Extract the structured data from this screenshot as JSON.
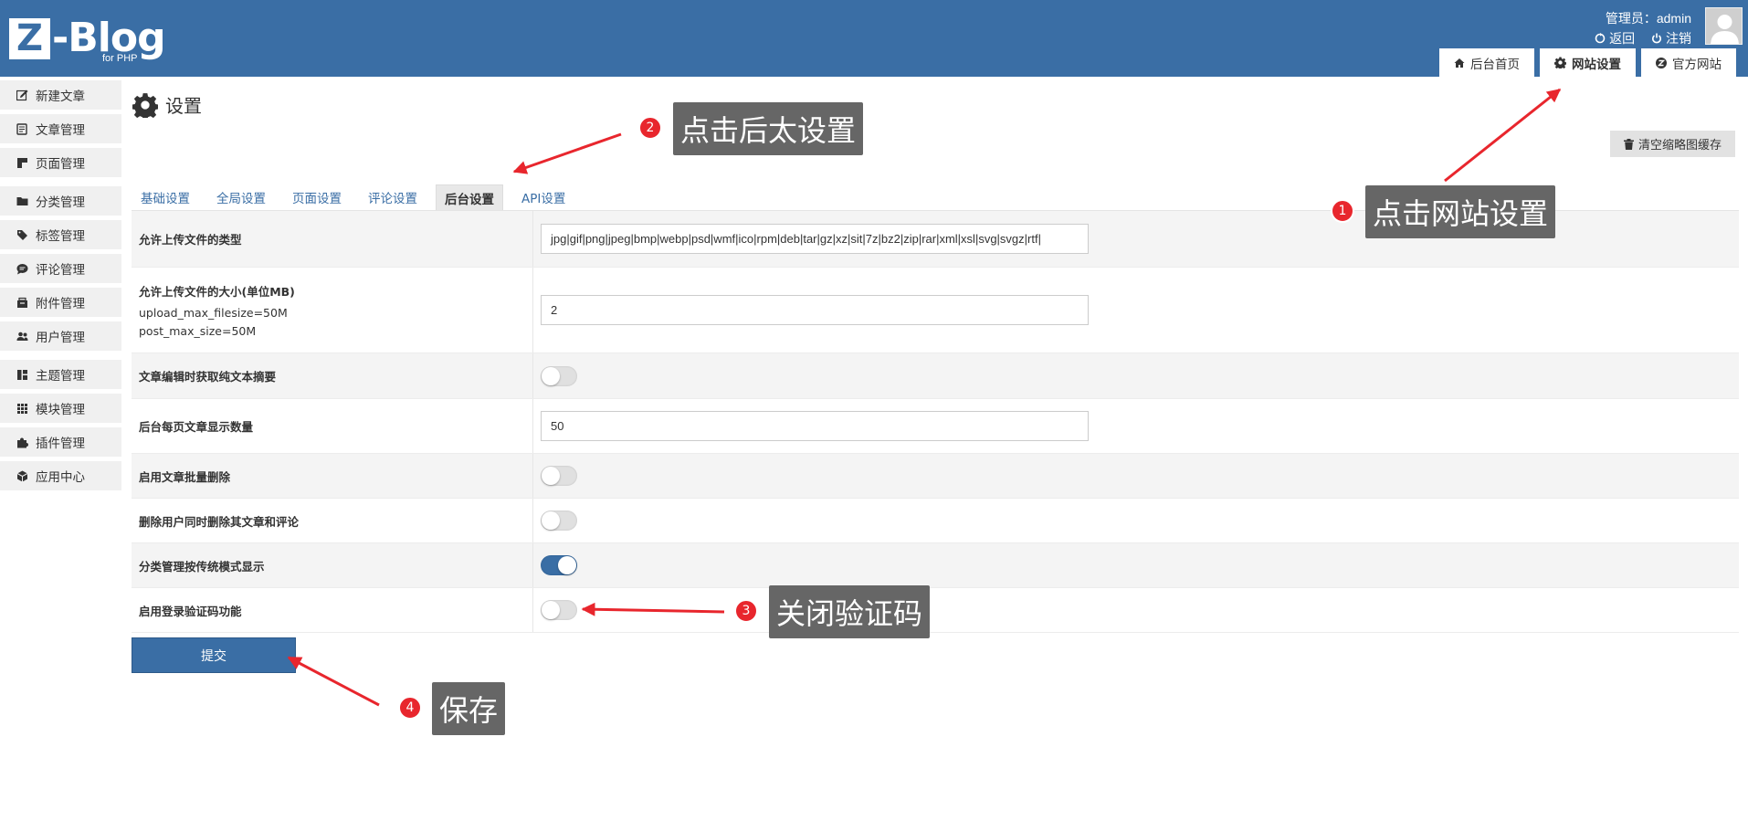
{
  "header": {
    "logo_z": "Z",
    "logo_text": "-Blog",
    "logo_sub": "for PHP",
    "user_label": "管理员：admin",
    "back_label": "返回",
    "logout_label": "注销",
    "nav": [
      {
        "label": "后台首页",
        "icon": "home-icon"
      },
      {
        "label": "网站设置",
        "icon": "gear-icon"
      },
      {
        "label": "官方网站",
        "icon": "zblog-icon"
      }
    ]
  },
  "sidebar": {
    "items": [
      {
        "label": "新建文章",
        "icon": "edit-icon"
      },
      {
        "label": "文章管理",
        "icon": "article-icon"
      },
      {
        "label": "页面管理",
        "icon": "page-icon"
      },
      {
        "label": "分类管理",
        "icon": "folder-icon"
      },
      {
        "label": "标签管理",
        "icon": "tag-icon"
      },
      {
        "label": "评论管理",
        "icon": "comment-icon"
      },
      {
        "label": "附件管理",
        "icon": "attachment-icon"
      },
      {
        "label": "用户管理",
        "icon": "users-icon"
      },
      {
        "label": "主题管理",
        "icon": "theme-icon"
      },
      {
        "label": "模块管理",
        "icon": "grid-icon"
      },
      {
        "label": "插件管理",
        "icon": "puzzle-icon"
      },
      {
        "label": "应用中心",
        "icon": "box-icon"
      }
    ]
  },
  "main": {
    "title": "设置",
    "clear_cache": "清空缩略图缓存",
    "tabs": [
      {
        "label": "基础设置"
      },
      {
        "label": "全局设置"
      },
      {
        "label": "页面设置"
      },
      {
        "label": "评论设置"
      },
      {
        "label": "后台设置"
      },
      {
        "label": "API设置"
      }
    ],
    "rows": [
      {
        "label": "允许上传文件的类型",
        "value": "jpg|gif|png|jpeg|bmp|webp|psd|wmf|ico|rpm|deb|tar|gz|xz|sit|7z|bz2|zip|rar|xml|xsl|svg|svgz|rtf|"
      },
      {
        "label": "允许上传文件的大小(单位MB)",
        "note1": "upload_max_filesize=50M",
        "note2": "post_max_size=50M",
        "value": "2"
      },
      {
        "label": "文章编辑时获取纯文本摘要",
        "on": false
      },
      {
        "label": "后台每页文章显示数量",
        "value": "50"
      },
      {
        "label": "启用文章批量删除",
        "on": false
      },
      {
        "label": "删除用户同时删除其文章和评论",
        "on": false
      },
      {
        "label": "分类管理按传统模式显示",
        "on": true
      },
      {
        "label": "启用登录验证码功能",
        "on": false
      }
    ],
    "submit": "提交"
  },
  "annotations": [
    {
      "num": "1",
      "text": "点击网站设置"
    },
    {
      "num": "2",
      "text": "点击后太设置"
    },
    {
      "num": "3",
      "text": "关闭验证码"
    },
    {
      "num": "4",
      "text": "保存"
    }
  ],
  "colors": {
    "brand": "#3a6ea5",
    "annotation": "#e8262d",
    "callout_bg": "#666666"
  }
}
